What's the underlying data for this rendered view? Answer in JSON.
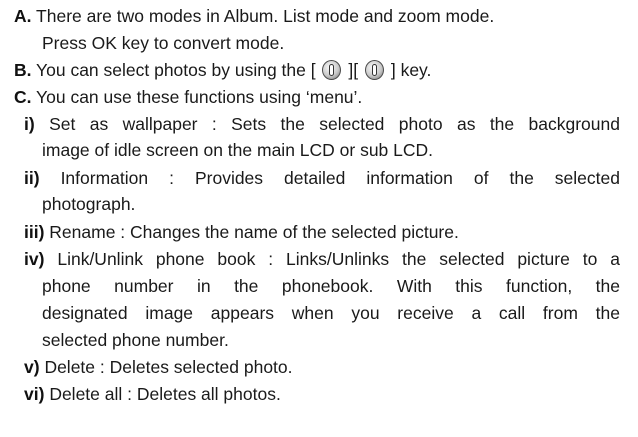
{
  "items": {
    "a": {
      "marker": "A.",
      "line1": "There are two modes in Album. List mode and zoom mode.",
      "line2": "Press OK key to convert mode."
    },
    "b": {
      "marker": "B.",
      "before": "You can select photos by using the [",
      "mid": "][",
      "after": "] key."
    },
    "c": {
      "marker": "C.",
      "text": "You can use these functions using ‘menu’."
    }
  },
  "subitems": {
    "i": {
      "marker": "i)",
      "line1": "Set as wallpaper : Sets the selected photo as the background",
      "line2": "image of idle screen on the main LCD or sub LCD."
    },
    "ii": {
      "marker": "ii)",
      "line1": "Information : Provides detailed information of the selected",
      "line2": "photograph."
    },
    "iii": {
      "marker": "iii)",
      "line1": "Rename : Changes the name of the selected picture."
    },
    "iv": {
      "marker": "iv)",
      "line1": "Link/Unlink phone book : Links/Unlinks the selected picture to a",
      "line2": "phone number in the phonebook. With this function, the",
      "line3": "designated image appears when you receive a call from the",
      "line4": "selected phone number."
    },
    "v": {
      "marker": "v)",
      "line1": "Delete : Deletes selected photo."
    },
    "vi": {
      "marker": "vi)",
      "line1": "Delete all : Deletes all photos."
    }
  },
  "icons": [
    "navigation-key-up-down-icon",
    "navigation-key-up-down-icon"
  ]
}
